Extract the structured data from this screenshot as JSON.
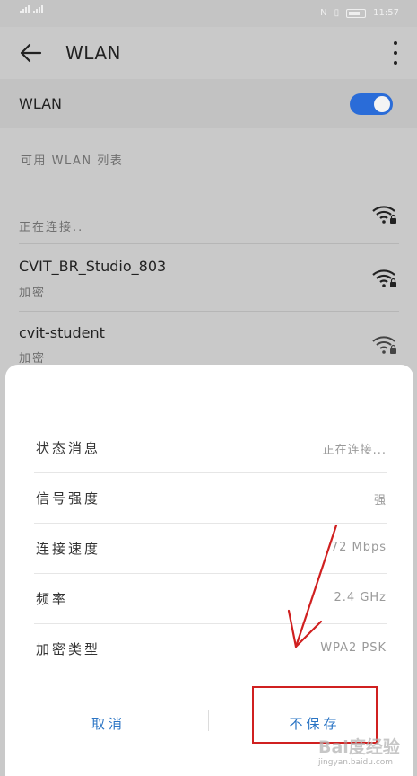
{
  "status_bar": {
    "time": "11:57"
  },
  "app_bar": {
    "title": "WLAN"
  },
  "wlan_toggle": {
    "label": "WLAN",
    "enabled": true
  },
  "section_title": "可用 WLAN 列表",
  "networks": [
    {
      "name": "",
      "status": "正在连接..",
      "icon": "wifi-locked-icon"
    },
    {
      "name": "CVIT_BR_Studio_803",
      "status": "加密",
      "icon": "wifi-locked-icon"
    },
    {
      "name": "cvit-student",
      "status": "加密",
      "icon": "wifi-locked-icon"
    }
  ],
  "dialog": {
    "rows": [
      {
        "label": "状态消息",
        "value": "正在连接..."
      },
      {
        "label": "信号强度",
        "value": "强"
      },
      {
        "label": "连接速度",
        "value": "72 Mbps"
      },
      {
        "label": "频率",
        "value": "2.4 GHz"
      },
      {
        "label": "加密类型",
        "value": "WPA2 PSK"
      }
    ],
    "cancel_label": "取消",
    "dont_save_label": "不保存"
  },
  "watermark": {
    "main": "Bai度经验",
    "sub": "jingyan.baidu.com"
  },
  "colors": {
    "accent": "#2a6cd8",
    "annotation": "#d02020",
    "dim_background": "#c9c9c9",
    "button_text": "#2a74c4"
  }
}
